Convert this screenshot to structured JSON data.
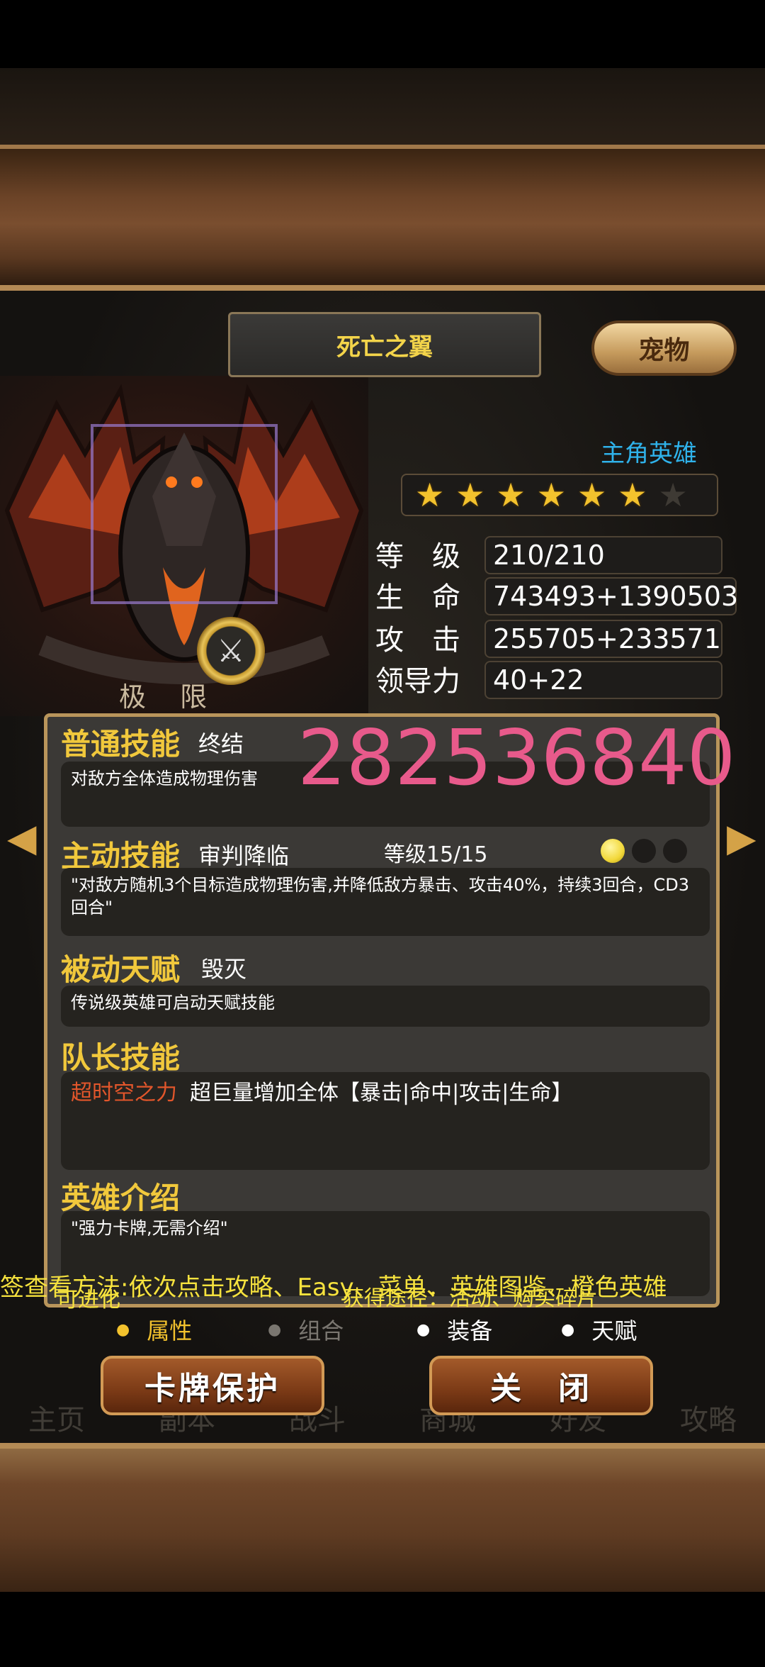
{
  "hero": {
    "name": "死亡之翼",
    "role": "主角英雄",
    "stars_filled": 6,
    "stars_total": 7,
    "limit_label": "极 限"
  },
  "pet_button": "宠物",
  "stats": {
    "level_label": "等　级",
    "level_value": "210/210",
    "hp_label": "生　命",
    "hp_value": "743493+1390503",
    "atk_label": "攻　击",
    "atk_value": "255705+233571",
    "lead_label": "领导力",
    "lead_value": "40+22"
  },
  "overlay_number": "282536840",
  "skills": {
    "normal": {
      "title": "普通技能",
      "name": "终结",
      "desc": "对敌方全体造成物理伤害"
    },
    "active": {
      "title": "主动技能",
      "name": "审判降临",
      "level": "等级15/15",
      "desc": "\"对敌方随机3个目标造成物理伤害,并降低敌方暴击、攻击40%，持续3回合，CD3回合\"",
      "level_dots_on": 1,
      "level_dots_total": 3
    },
    "passive": {
      "title": "被动天赋",
      "name": "毁灭",
      "desc": "传说级英雄可启动天赋技能"
    },
    "captain": {
      "title": "队长技能",
      "name": "超时空之力",
      "desc": "超巨量增加全体【暴击|命中|攻击|生命】"
    },
    "intro": {
      "title": "英雄介绍",
      "desc": "\"强力卡牌,无需介绍\""
    }
  },
  "ticker": {
    "line1": "签查看方法:依次点击攻略、Easy、菜单、英雄图鉴、橙色英雄",
    "line2": "可进化",
    "line3": "获得途径：活动、购买碎片"
  },
  "tabs": [
    {
      "label": "属性",
      "active": true
    },
    {
      "label": "组合",
      "active": false
    },
    {
      "label": "装备",
      "active": true
    },
    {
      "label": "天赋",
      "active": true
    }
  ],
  "buttons": {
    "protect": "卡牌保护",
    "close": "关　闭"
  },
  "background_nav": [
    "主页",
    "副本",
    "战斗",
    "商城",
    "好友",
    "攻略"
  ],
  "colors": {
    "gold_title": "#f1c83c",
    "score_pink": "#e85a8b",
    "role_blue": "#2fb2ea",
    "captain_red": "#e2562b"
  }
}
